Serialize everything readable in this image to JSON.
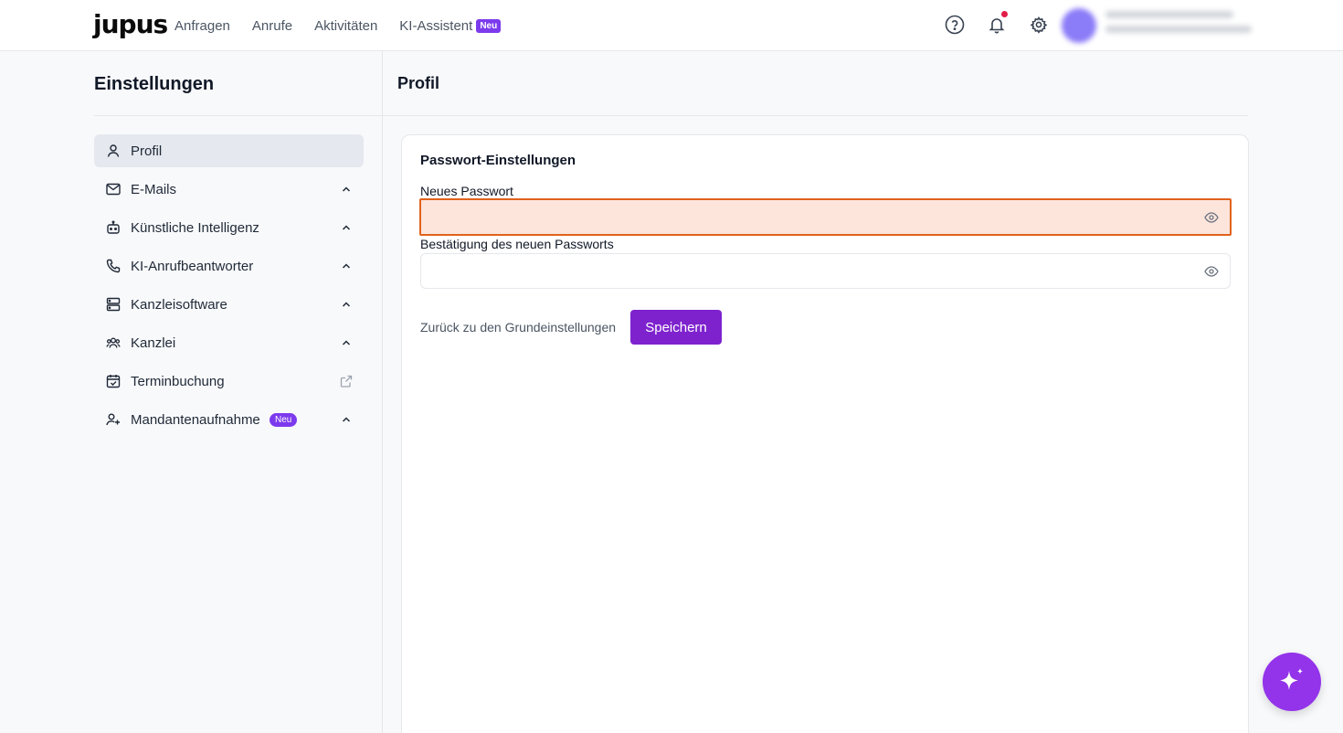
{
  "brand": {
    "logo_text": "jupus"
  },
  "topnav": {
    "items": [
      {
        "label": "Anfragen"
      },
      {
        "label": "Anrufe"
      },
      {
        "label": "Aktivitäten"
      },
      {
        "label": "KI-Assistent",
        "badge": "Neu"
      }
    ],
    "icons": [
      "help-circle-icon",
      "bell-icon",
      "gear-icon"
    ]
  },
  "sidebar": {
    "title": "Einstellungen",
    "items": [
      {
        "label": "Profil",
        "icon": "user-icon",
        "active": true
      },
      {
        "label": "E-Mails",
        "icon": "mail-icon",
        "expandable": true
      },
      {
        "label": "Künstliche Intelligenz",
        "icon": "robot-icon",
        "expandable": true
      },
      {
        "label": "KI-Anrufbeantworter",
        "icon": "phone-icon",
        "expandable": true
      },
      {
        "label": "Kanzleisoftware",
        "icon": "server-icon",
        "expandable": true
      },
      {
        "label": "Kanzlei",
        "icon": "users-icon",
        "expandable": true
      },
      {
        "label": "Terminbuchung",
        "icon": "calendar-check-icon",
        "external": true
      },
      {
        "label": "Mandantenaufnahme",
        "icon": "user-plus-icon",
        "badge": "Neu",
        "expandable": true
      }
    ]
  },
  "main": {
    "title": "Profil",
    "card": {
      "title": "Passwort-Einstellungen",
      "new_password": {
        "label": "Neues Passwort",
        "value": ""
      },
      "confirm_password": {
        "label": "Bestätigung des neuen Passworts",
        "value": ""
      },
      "back_label": "Zurück zu den Grundeinstellungen",
      "save_label": "Speichern"
    }
  },
  "colors": {
    "accent": "#7e22ce",
    "badge": "#7c3aed",
    "error_border": "#e0621b",
    "error_bg": "#fde5dc",
    "notification_dot": "#e11d48"
  }
}
